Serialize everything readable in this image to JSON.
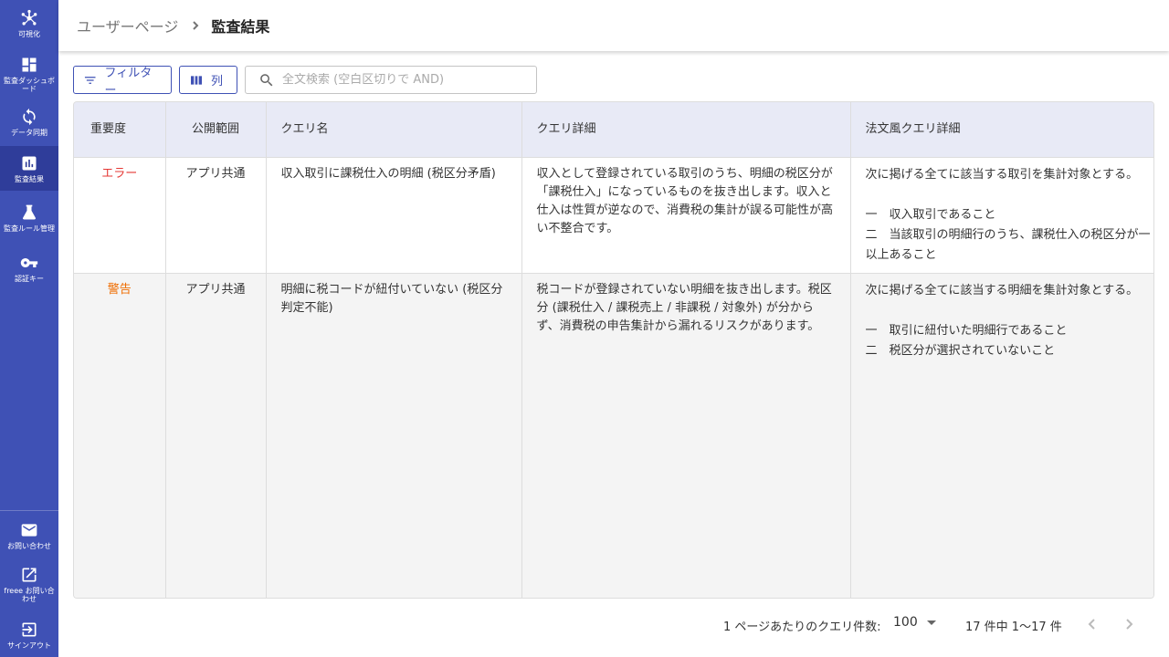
{
  "sidebar": {
    "items": [
      {
        "label": "可視化",
        "icon": "hub-icon"
      },
      {
        "label": "監査ダッシュボード",
        "icon": "dashboard-icon"
      },
      {
        "label": "データ同期",
        "icon": "sync-icon"
      },
      {
        "label": "監査結果",
        "icon": "bar-chart-icon",
        "active": true
      },
      {
        "label": "監査ルール管理",
        "icon": "flask-icon"
      },
      {
        "label": "認証キー",
        "icon": "key-icon"
      }
    ],
    "bottom_items": [
      {
        "label": "お問い合わせ",
        "icon": "mail-icon"
      },
      {
        "label": "freee お問い合わせ",
        "icon": "open-in-new-icon"
      },
      {
        "label": "サインアウト",
        "icon": "logout-icon"
      }
    ]
  },
  "breadcrumb": {
    "parent": "ユーザーページ",
    "current": "監査結果"
  },
  "toolbar": {
    "filter_label": "フィルター",
    "columns_label": "列",
    "search_placeholder": "全文検索 (空白区切りで AND)"
  },
  "table": {
    "columns": {
      "severity": "重要度",
      "scope": "公開範囲",
      "query_name": "クエリ名",
      "query_detail": "クエリ詳細",
      "legal_detail": "法文風クエリ詳細"
    },
    "rows": [
      {
        "severity": "エラー",
        "scope": "アプリ共通",
        "query_name": "収入取引に課税仕入の明細 (税区分矛盾)",
        "query_detail": "収入として登録されている取引のうち、明細の税区分が「課税仕入」になっているものを抜き出します。収入と仕入は性質が逆なので、消費税の集計が誤る可能性が高い不整合です。",
        "legal_intro": "次に掲げる全てに該当する取引を集計対象とする。",
        "legal_items": [
          "一　収入取引であること",
          "二　当該取引の明細行のうち、課税仕入の税区分が一以上あること"
        ]
      },
      {
        "severity": "警告",
        "scope": "アプリ共通",
        "query_name": "明細に税コードが紐付いていない (税区分判定不能)",
        "query_detail": "税コードが登録されていない明細を抜き出します。税区分 (課税仕入 / 課税売上 / 非課税 / 対象外) が分からず、消費税の申告集計から漏れるリスクがあります。",
        "legal_intro": "次に掲げる全てに該当する明細を集計対象とする。",
        "legal_items": [
          "一　取引に紐付いた明細行であること",
          "二　税区分が選択されていないこと"
        ]
      }
    ]
  },
  "pagination": {
    "rows_per_page_label": "1 ページあたりのクエリ件数:",
    "rows_per_page_value": "100",
    "range_text": "17 件中 1〜17 件"
  },
  "colors": {
    "sidebar": "#3f51b5",
    "sidebar_active": "#2f3d9a",
    "header_row": "#e8eaf6",
    "error": "#e53935",
    "warning": "#ef6c00"
  }
}
